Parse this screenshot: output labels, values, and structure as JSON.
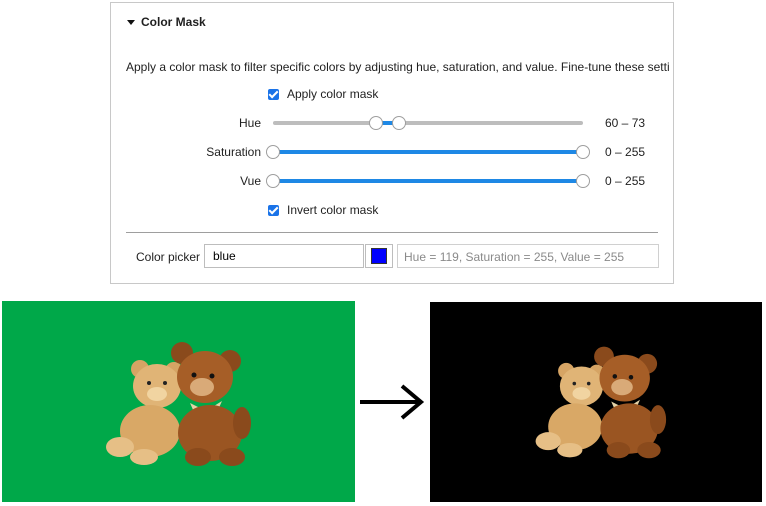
{
  "panel": {
    "title": "Color Mask",
    "description": "Apply a color mask to filter specific colors by adjusting hue, saturation, and value. Fine-tune these settings",
    "apply_label": "Apply color mask",
    "apply_checked": true,
    "invert_label": "Invert color mask",
    "invert_checked": true
  },
  "sliders": [
    {
      "label": "Hue",
      "value_text": "60 – 73",
      "min": 0,
      "max": 180,
      "low": 60,
      "high": 73
    },
    {
      "label": "Saturation",
      "value_text": "0 – 255",
      "min": 0,
      "max": 255,
      "low": 0,
      "high": 255
    },
    {
      "label": "Vue",
      "value_text": "0 – 255",
      "min": 0,
      "max": 255,
      "low": 0,
      "high": 255
    }
  ],
  "picker": {
    "label": "Color picker",
    "value": "blue",
    "swatch_color": "#0000ff",
    "readout": "Hue = 119, Saturation = 255, Value = 255"
  },
  "images": {
    "before_background": "#00a849",
    "after_background": "#000000",
    "arrow_icon": "right-arrow-icon"
  }
}
